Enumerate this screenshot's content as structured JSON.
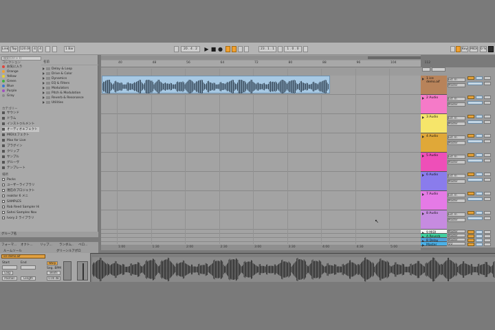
{
  "toolbar": {
    "link": "Link",
    "tap": "Tap",
    "tempo": "120.00",
    "time_sig_num": "4",
    "time_sig_den": "4",
    "quant": "1 Bar",
    "position": "20 . 4 . 2",
    "loop_start": "23 . 1 . 1",
    "loop_len": "1 . 0 . 0",
    "key": "Key",
    "midi": "MIDI",
    "cpu": "0 %"
  },
  "browser": {
    "search_placeholder": "検索(Ctrl + F)",
    "collections_heading": "コレクション",
    "collections": [
      {
        "label": "お気に入り",
        "color": "#e0463c"
      },
      {
        "label": "Orange",
        "color": "#f0a030"
      },
      {
        "label": "Yellow",
        "color": "#e8d030"
      },
      {
        "label": "Green",
        "color": "#40b040"
      },
      {
        "label": "Blue",
        "color": "#3a78d0"
      },
      {
        "label": "Purple",
        "color": "#a050c0"
      },
      {
        "label": "Gray",
        "color": "#8a8a8a"
      }
    ],
    "categories_heading": "カテゴリー",
    "categories": [
      "サウンド",
      "ドラム",
      "インストゥルメント",
      "オーディオエフェクト",
      "MIDIエフェクト",
      "Max for Live",
      "プラグイン",
      "クリップ",
      "サンプル",
      "グルーヴ",
      "テンプレート"
    ],
    "selected_category": "オーディオエフェクト",
    "places_heading": "場所",
    "places": [
      "Packs",
      "ユーザーライブラリ",
      "現在のプロジェクト",
      "reaktor 6 メニ",
      "SAMPLES",
      "Rob Reed Sampler Hier",
      "Sahni Samples Nov",
      "Ivory 2 ライブラリ"
    ],
    "files_heading": "名前",
    "files": [
      "Delay & Loop",
      "Drive & Color",
      "Dynamics",
      "EQ & Filters",
      "Modulators",
      "Pitch & Modulation",
      "Reverb & Resonance",
      "Utilities"
    ],
    "info_label": "グループ名",
    "bottom_left": "ルームソール",
    "bottom_right": "グリーンルアポロ",
    "group_bar": [
      "フォーマ...",
      "オクト...",
      "リップ...",
      "ランダム..",
      "ベロ..."
    ]
  },
  "ruler": [
    "40",
    "48",
    "56",
    "64",
    "72",
    "80",
    "88",
    "96",
    "104",
    "112"
  ],
  "bottom_ruler": [
    "1:00",
    "1:30",
    "2:00",
    "2:30",
    "3:00",
    "3:30",
    "4:00",
    "4:30",
    "5:00"
  ],
  "tracks": [
    {
      "name": "1 ice demo.aif",
      "color": "#b8835a",
      "input": "Ext. In",
      "route": "Master"
    },
    {
      "name": "2 Audio",
      "color": "#f57ac8",
      "input": "Ext. In",
      "route": "Master"
    },
    {
      "name": "3 Audio",
      "color": "#f6e56a",
      "input": "Ext. In",
      "route": "Master"
    },
    {
      "name": "4 Audio",
      "color": "#e0a838",
      "input": "Ext. In",
      "route": "Master"
    },
    {
      "name": "5 Audio",
      "color": "#ee4fb8",
      "input": "Ext. In",
      "route": "Master"
    },
    {
      "name": "6 Audio",
      "color": "#8a7cec",
      "input": "Ext. In",
      "route": "Master"
    },
    {
      "name": "7 Audio",
      "color": "#e57ae6",
      "input": "Ext. In",
      "route": "Master"
    },
    {
      "name": "8 Audio",
      "color": "#c68be0",
      "input": "Ext. In",
      "route": "Master"
    },
    {
      "name": "9 MIDI",
      "color": "#f4f4f4",
      "input": "All Ins",
      "route": "Master"
    },
    {
      "name": "A Reverb",
      "color": "#40d0a0",
      "input": "",
      "route": "Master"
    },
    {
      "name": "B Delay",
      "color": "#50a0d8",
      "input": "",
      "route": "Master"
    },
    {
      "name": "Master",
      "color": "#4ab0e8",
      "input": "",
      "route": "1/2"
    }
  ],
  "clip": {
    "name": "ice demo.aif"
  },
  "detail": {
    "clip_name": "ice demo.aif",
    "start_label": "Start",
    "end_label": "End",
    "warp": "Warp",
    "seg_bpm": "Seg. BPM",
    "mode": "Beats",
    "gain": "0.00 dB",
    "loop": "Loop",
    "position_label": "Position",
    "length_label": "Length"
  },
  "colors": {
    "accent": "#f0a030",
    "clip": "#a7c9e4",
    "clip_header": "#c07a3c"
  }
}
